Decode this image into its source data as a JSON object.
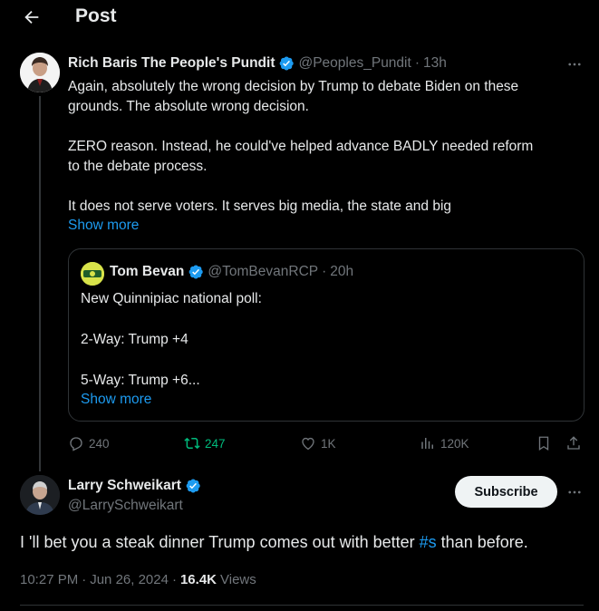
{
  "header": {
    "title": "Post"
  },
  "tweet1": {
    "name": "Rich Baris The People's Pundit",
    "handle": "@Peoples_Pundit",
    "time": "13h",
    "lines": [
      "Again, absolutely the wrong decision by Trump to debate Biden on these",
      "grounds. The absolute wrong decision.",
      "ZERO reason. Instead, he could've helped advance BADLY needed reform",
      "to the debate process.",
      "It does not serve voters. It serves big media, the state and big"
    ],
    "show_more": "Show more"
  },
  "quote": {
    "name": "Tom Bevan",
    "handle": "@TomBevanRCP",
    "time": "20h",
    "lines": [
      "New Quinnipiac national poll:",
      "2-Way: Trump +4",
      "5-Way: Trump +6..."
    ],
    "show_more": "Show more"
  },
  "actions": {
    "replies": "240",
    "reposts": "247",
    "likes": "1K",
    "views": "120K",
    "repost_color": "#00ba7c"
  },
  "tweet2": {
    "name": "Larry Schweikart",
    "handle": "@LarrySchweikart",
    "subscribe_label": "Subscribe",
    "text_before": "I 'll bet you a steak dinner Trump comes out with better ",
    "hashtag": "#s",
    "text_after": " than before.",
    "time": "10:27 PM",
    "date": "Jun 26, 2024",
    "views_count": "16.4K",
    "views_label": "Views"
  },
  "colors": {
    "background": "#000000",
    "link": "#1d9bf0",
    "verified": "#1d9bf0",
    "muted": "#71767b"
  },
  "icons": [
    "back-arrow-icon",
    "verified-badge-icon",
    "more-icon",
    "reply-icon",
    "repost-icon",
    "like-icon",
    "views-icon",
    "bookmark-icon",
    "share-icon"
  ]
}
